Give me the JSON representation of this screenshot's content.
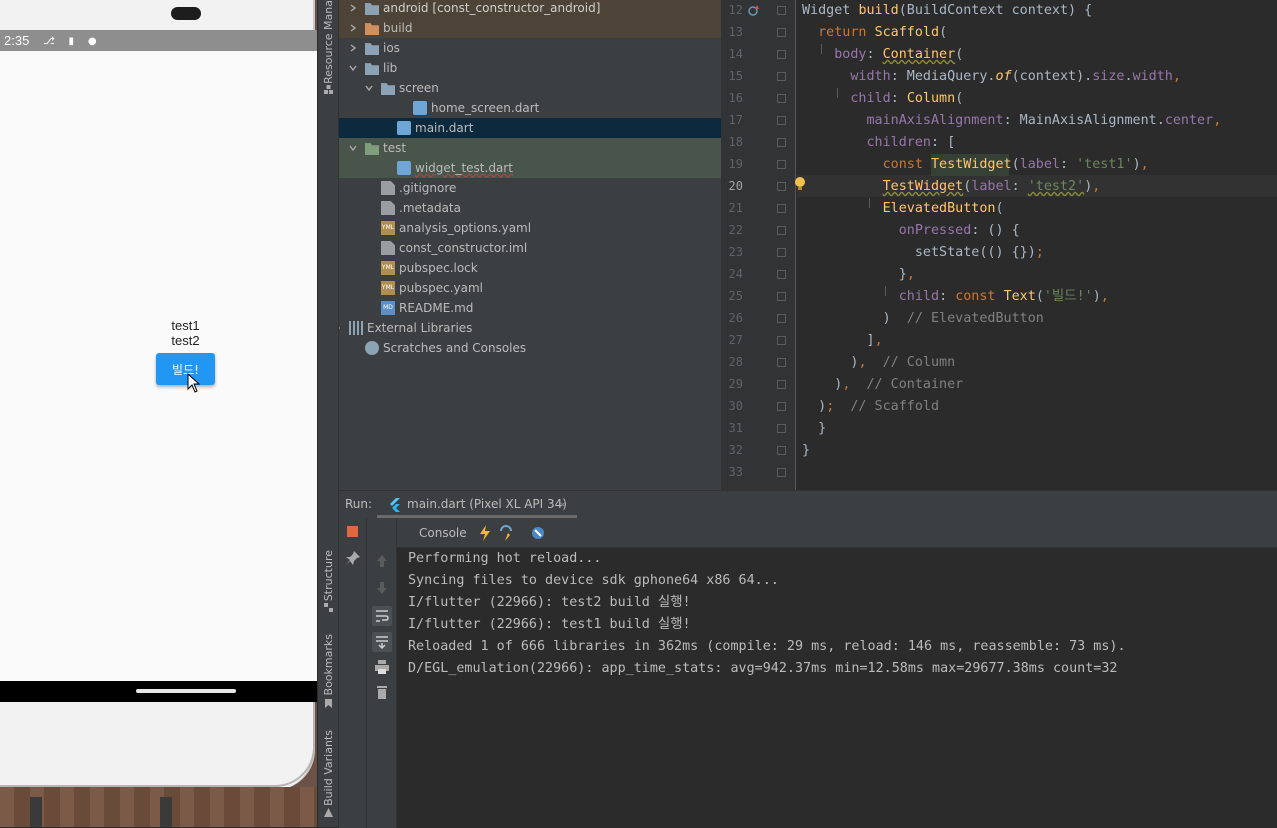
{
  "emulator": {
    "status_time": "2:35",
    "texts": [
      "test1",
      "test2"
    ],
    "button_label": "빌드!"
  },
  "side_tabs": {
    "resource_manager": "Resource Mana",
    "structure": "Structure",
    "bookmarks": "Bookmarks",
    "build_variants": "Build Variants"
  },
  "project_tree": [
    {
      "label": "android [const_constructor_android]",
      "indent": 1,
      "chevron": "right",
      "icon": "folder"
    },
    {
      "label": "build",
      "indent": 1,
      "chevron": "right",
      "icon": "folder-build"
    },
    {
      "label": "ios",
      "indent": 1,
      "chevron": "right",
      "icon": "folder"
    },
    {
      "label": "lib",
      "indent": 1,
      "chevron": "down",
      "icon": "folder"
    },
    {
      "label": "screen",
      "indent": 2,
      "chevron": "down",
      "icon": "folder"
    },
    {
      "label": "home_screen.dart",
      "indent": 4,
      "chevron": "",
      "icon": "dart"
    },
    {
      "label": "main.dart",
      "indent": 3,
      "chevron": "",
      "icon": "dart"
    },
    {
      "label": "test",
      "indent": 1,
      "chevron": "down",
      "icon": "folder-test"
    },
    {
      "label": "widget_test.dart",
      "indent": 3,
      "chevron": "",
      "icon": "dart"
    },
    {
      "label": ".gitignore",
      "indent": 2,
      "chevron": "",
      "icon": "file"
    },
    {
      "label": ".metadata",
      "indent": 2,
      "chevron": "",
      "icon": "file"
    },
    {
      "label": "analysis_options.yaml",
      "indent": 2,
      "chevron": "",
      "icon": "yml"
    },
    {
      "label": "const_constructor.iml",
      "indent": 2,
      "chevron": "",
      "icon": "file"
    },
    {
      "label": "pubspec.lock",
      "indent": 2,
      "chevron": "",
      "icon": "yml"
    },
    {
      "label": "pubspec.yaml",
      "indent": 2,
      "chevron": "",
      "icon": "yml"
    },
    {
      "label": "README.md",
      "indent": 2,
      "chevron": "",
      "icon": "md"
    },
    {
      "label": "External Libraries",
      "indent": 0,
      "chevron": "right",
      "icon": "lib"
    },
    {
      "label": "Scratches and Consoles",
      "indent": 1,
      "chevron": "",
      "icon": "scratch"
    }
  ],
  "editor": {
    "line_numbers": [
      "12",
      "13",
      "14",
      "15",
      "16",
      "17",
      "18",
      "19",
      "20",
      "21",
      "22",
      "23",
      "24",
      "25",
      "26",
      "27",
      "28",
      "29",
      "30",
      "31",
      "32",
      "33"
    ],
    "current_line": "20"
  },
  "run": {
    "label": "Run:",
    "tab_label": "main.dart (Pixel XL API 34)",
    "tab_close": "×",
    "console_label": "Console",
    "output": [
      "Performing hot reload...",
      "Syncing files to device sdk gphone64 x86 64...",
      "I/flutter (22966): test2 build 실행!",
      "I/flutter (22966): test1 build 실행!",
      "Reloaded 1 of 666 libraries in 362ms (compile: 29 ms, reload: 146 ms, reassemble: 73 ms).",
      "D/EGL_emulation(22966): app_time_stats: avg=942.37ms min=12.58ms max=29677.38ms count=32"
    ]
  },
  "colors": {
    "accent_button": "#2196f3",
    "selected_row": "#0d293e",
    "test_folder_bg": "#49544a",
    "build_folder_bg": "#4d4437"
  }
}
